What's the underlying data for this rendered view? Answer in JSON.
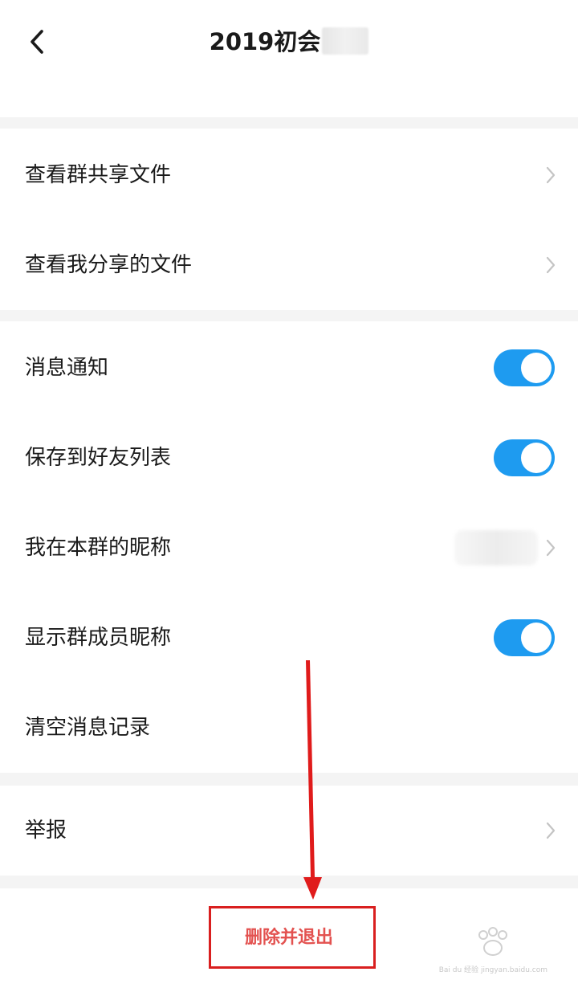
{
  "header": {
    "title": "2019初会"
  },
  "sections": {
    "files": [
      {
        "label": "查看群共享文件"
      },
      {
        "label": "查看我分享的文件"
      }
    ],
    "settings": [
      {
        "label": "消息通知",
        "toggle": true
      },
      {
        "label": "保存到好友列表",
        "toggle": true
      },
      {
        "label": "我在本群的昵称"
      },
      {
        "label": "显示群成员昵称",
        "toggle": true
      },
      {
        "label": "清空消息记录"
      }
    ],
    "report": {
      "label": "举报"
    }
  },
  "actions": {
    "delete_exit": "删除并退出"
  },
  "watermark": {
    "brand": "Bai du 经验",
    "url": "jingyan.baidu.com"
  },
  "colors": {
    "accent": "#1e9bf0",
    "danger": "#e35250",
    "annotation": "#d91f1f"
  }
}
